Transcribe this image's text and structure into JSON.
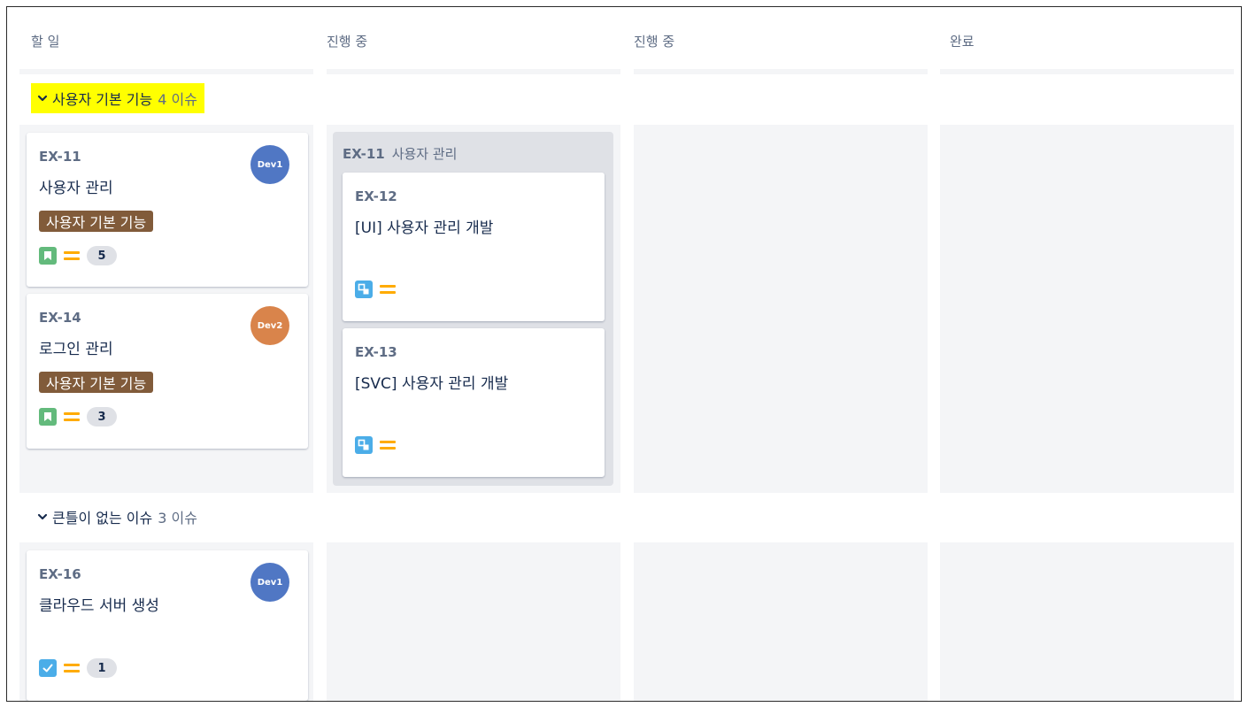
{
  "columns": [
    {
      "title": "할 일"
    },
    {
      "title": "진행 중"
    },
    {
      "title": "진행 중"
    },
    {
      "title": "완료"
    }
  ],
  "swimlanes": [
    {
      "title": "사용자 기본 기능",
      "count": "4 이슈",
      "highlight": "#ffff00",
      "cards": [
        {
          "key": "EX-11",
          "summary": "사용자 관리",
          "avatar": "Dev1",
          "avatar_color": "#5077c4",
          "epic": "사용자 기본 기능",
          "epic_color": "#815b3a",
          "type_icon": "story-bookmark-icon",
          "priority": "medium-priority-icon",
          "badge": "5"
        },
        {
          "key": "EX-14",
          "summary": "로그인 관리",
          "avatar": "Dev2",
          "avatar_color": "#d9844b",
          "epic": "사용자 기본 기능",
          "epic_color": "#815b3a",
          "type_icon": "story-bookmark-icon",
          "priority": "medium-priority-icon",
          "badge": "3"
        }
      ],
      "parent_group": {
        "key": "EX-11",
        "summary": "사용자 관리",
        "subtasks": [
          {
            "key": "EX-12",
            "summary": "[UI] 사용자 관리 개발",
            "type_icon": "subtask-icon",
            "priority": "medium-priority-icon"
          },
          {
            "key": "EX-13",
            "summary": "[SVC] 사용자 관리 개발",
            "type_icon": "subtask-icon",
            "priority": "medium-priority-icon"
          }
        ]
      }
    },
    {
      "title": "큰틀이 없는 이슈",
      "count": "3 이슈",
      "cards": [
        {
          "key": "EX-16",
          "summary": "클라우드 서버 생성",
          "avatar": "Dev1",
          "avatar_color": "#5077c4",
          "type_icon": "task-check-icon",
          "priority": "medium-priority-icon",
          "badge": "1"
        }
      ]
    }
  ],
  "colors": {
    "lane_bg": "#f4f5f7",
    "story": "#63ba7c",
    "subtask": "#4bade8",
    "task": "#4bade8",
    "priority_medium": "#ffab00"
  }
}
